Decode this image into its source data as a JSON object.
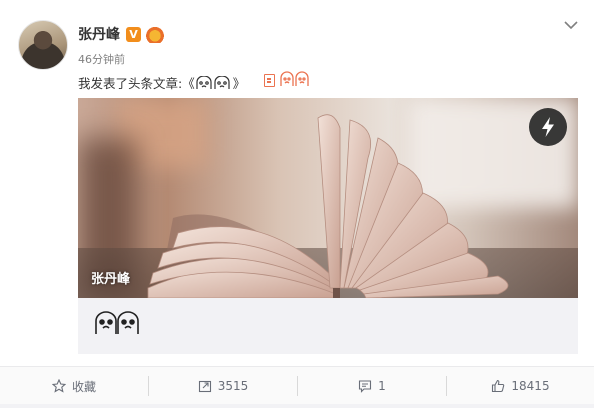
{
  "post": {
    "username": "张丹峰",
    "verified_badge": "V",
    "member_icon": "member-crown-icon",
    "time": "46分钟前",
    "text": "我发表了头条文章:《",
    "text_close": "》",
    "menu_icon": "chevron-down-icon",
    "article_icon": "article-icon",
    "emoji_name": "face-emoji-icon"
  },
  "card": {
    "caption": "张丹峰",
    "flash_icon": "lightning-icon"
  },
  "actions": {
    "favorite_label": "收藏",
    "repost_count": "3515",
    "comment_count": "1",
    "like_count": "18415"
  },
  "colors": {
    "accent": "#eb7350",
    "verified": "#f28e1c",
    "text_gray": "#808080",
    "action_text": "#696e78"
  }
}
